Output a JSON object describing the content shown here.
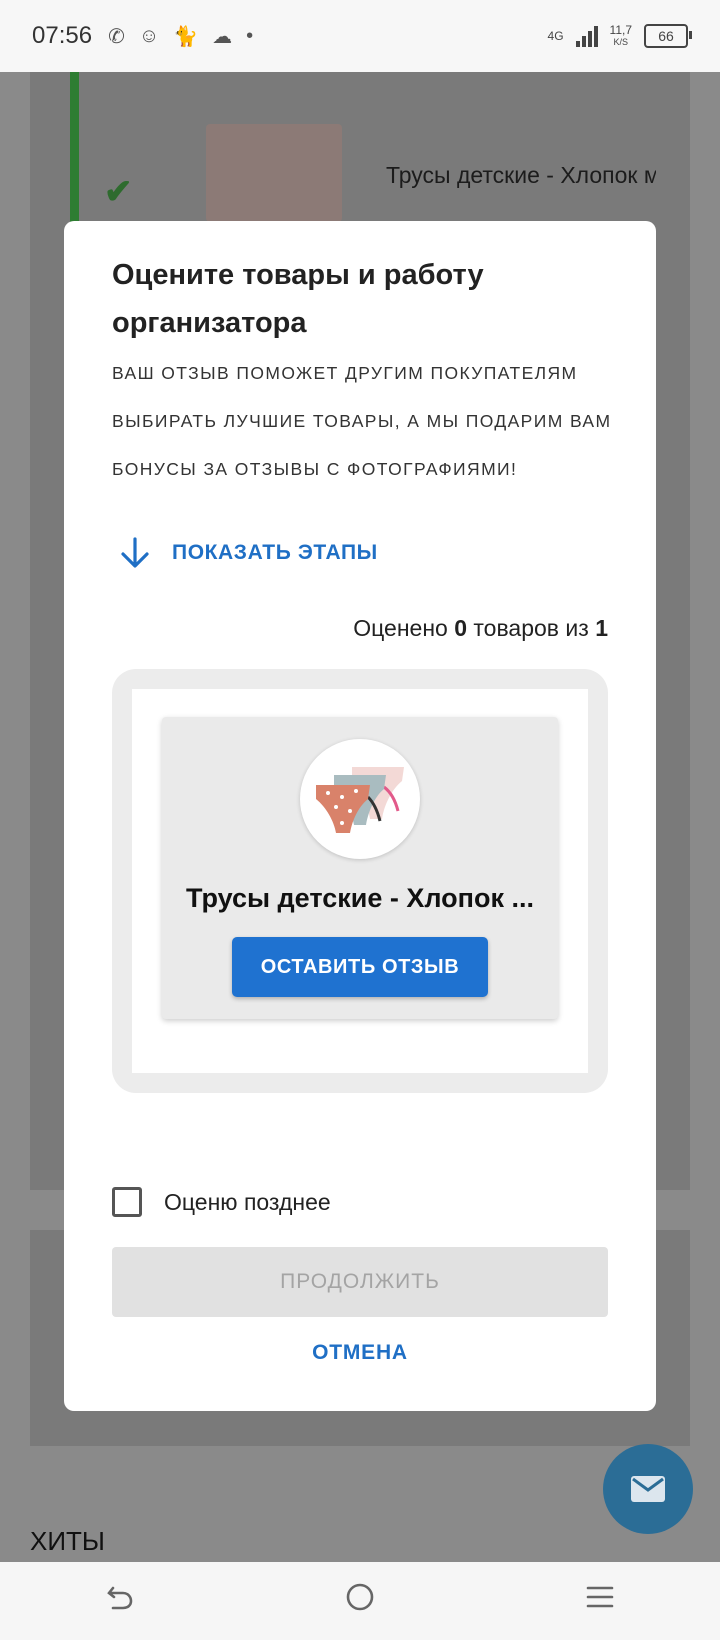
{
  "status_bar": {
    "time": "07:56",
    "network": "4G",
    "speed_value": "11,7",
    "speed_unit": "K/S",
    "battery": "66"
  },
  "background": {
    "order_item_title": "Трусы детские - Хлопок микс",
    "hits_heading": "ХИТЫ"
  },
  "dialog": {
    "title": "Оцените товары и работу организатора",
    "description": "Ваш отзыв поможет другим покупателям выбирать лучшие товары, а мы подарим вам бонусы за отзывы с фотографиями!",
    "show_steps_label": "ПОКАЗАТЬ ЭТАПЫ",
    "counter": {
      "prefix": "Оценено",
      "rated": "0",
      "middle": "товаров из",
      "total": "1"
    },
    "product": {
      "name": "Трусы детские - Хлопок ...",
      "review_button_label": "ОСТАВИТЬ ОТЗЫВ"
    },
    "rate_later_label": "Оценю позднее",
    "continue_label": "ПРОДОЛЖИТЬ",
    "cancel_label": "ОТМЕНА"
  },
  "colors": {
    "accent": "#1f72d0",
    "link": "#1f6fc5",
    "overlay": "#8a8a8a",
    "success": "#2e7d32"
  }
}
